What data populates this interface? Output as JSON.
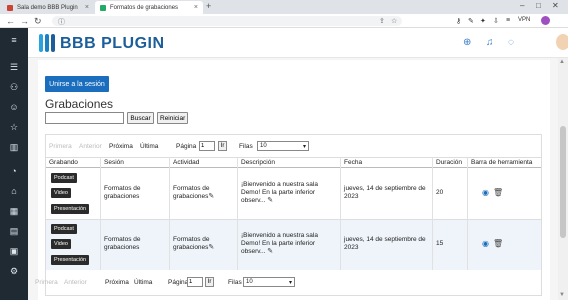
{
  "browser": {
    "tabs": [
      {
        "label": "Sala demo BBB Plugin",
        "active": false
      },
      {
        "label": "Formatos de grabaciones",
        "active": true
      }
    ],
    "vpn_label": "VPN"
  },
  "header": {
    "logo_text": "BBB PLUGIN",
    "brand_color": "#1b5e9a"
  },
  "main": {
    "join_button": "Unirse a la sesión",
    "title": "Grabaciones",
    "search_value": "",
    "search_button": "Buscar",
    "reset_button": "Reiniciar"
  },
  "pager": {
    "first": "Primera",
    "prev": "Anterior",
    "next": "Próxima",
    "last": "Última",
    "page_label": "Página",
    "page_value": "1",
    "go_button": "Ir",
    "rows_label": "Filas",
    "rows_value": "10"
  },
  "table": {
    "columns": [
      "Grabando",
      "Sesión",
      "Actividad",
      "Descripción",
      "Fecha",
      "Duración",
      "Barra de herramienta"
    ],
    "rows": [
      {
        "formats": [
          "Podcast",
          "Video",
          "Presentación"
        ],
        "session_l1": "Formatos de",
        "session_l2": "grabaciones",
        "activity_l1": "Formatos de",
        "activity_l2": "grabaciones",
        "desc_l1": "¡Bienvenido a nuestra sala",
        "desc_l2": "Demo! En la parte inferior",
        "desc_l3": "observ...",
        "date_l1": "jueves, 14 de septiembre de",
        "date_l2": "2023",
        "duration": "20"
      },
      {
        "formats": [
          "Podcast",
          "Video",
          "Presentación"
        ],
        "session_l1": "Formatos de",
        "session_l2": "grabaciones",
        "activity_l1": "Formatos de",
        "activity_l2": "grabaciones",
        "desc_l1": "¡Bienvenido a nuestra sala",
        "desc_l2": "Demo! En la parte inferior",
        "desc_l3": "observ...",
        "date_l1": "jueves, 14 de septiembre de",
        "date_l2": "2023",
        "duration": "15"
      }
    ]
  }
}
